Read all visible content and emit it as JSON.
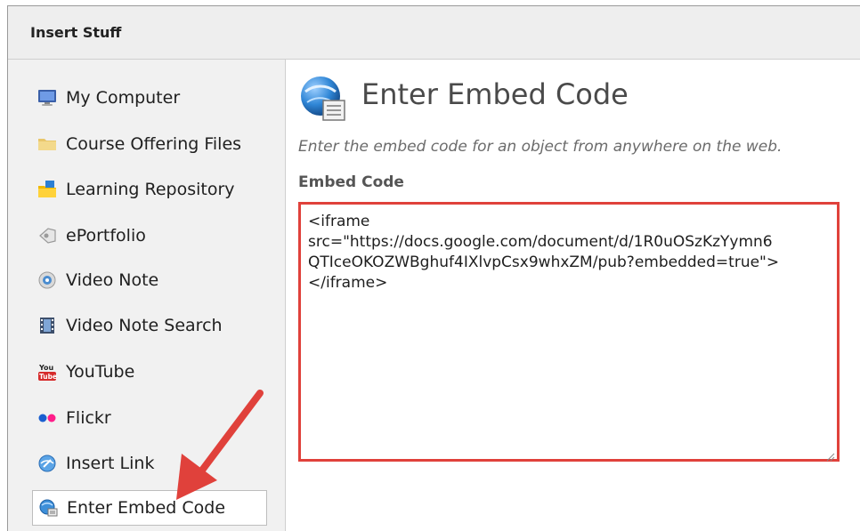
{
  "header": {
    "title": "Insert Stuff"
  },
  "sidebar": {
    "items": [
      {
        "label": "My Computer",
        "icon": "computer-icon"
      },
      {
        "label": "Course Offering Files",
        "icon": "folder-icon"
      },
      {
        "label": "Learning Repository",
        "icon": "repository-folder-icon"
      },
      {
        "label": "ePortfolio",
        "icon": "eportfolio-icon"
      },
      {
        "label": "Video Note",
        "icon": "video-note-icon"
      },
      {
        "label": "Video Note Search",
        "icon": "film-strip-icon"
      },
      {
        "label": "YouTube",
        "icon": "youtube-icon"
      },
      {
        "label": "Flickr",
        "icon": "flickr-icon"
      },
      {
        "label": "Insert Link",
        "icon": "link-globe-icon"
      },
      {
        "label": "Enter Embed Code",
        "icon": "embed-globe-icon",
        "selected": true
      }
    ]
  },
  "main": {
    "title": "Enter Embed Code",
    "description": "Enter the embed code for an object from anywhere on the web.",
    "field_label": "Embed Code",
    "embed_code": "<iframe\nsrc=\"https://docs.google.com/document/d/1R0uOSzKzYymn6\nQTIceOKOZWBghuf4IXlvpCsx9whxZM/pub?embedded=true\">\n</iframe>"
  },
  "colors": {
    "highlight_border": "#e0413b",
    "arrow": "#e0413b"
  }
}
